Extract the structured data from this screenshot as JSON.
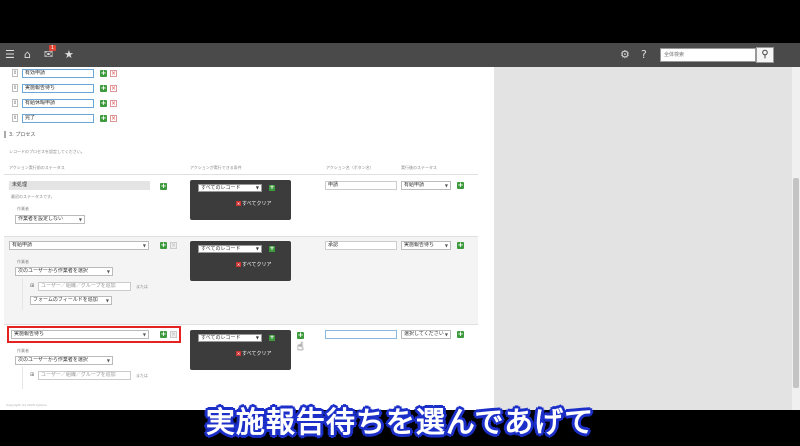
{
  "topbar": {
    "icons": [
      "menu-icon",
      "home-icon",
      "notifications-icon",
      "favorites-icon",
      "gear-icon",
      "help-icon",
      "search-icon"
    ],
    "notification_badge": "1",
    "search_placeholder": "全体検索"
  },
  "status_list": {
    "items": [
      {
        "label": "有効申請"
      },
      {
        "label": "実施報告待ち"
      },
      {
        "label": "有給休暇申請"
      },
      {
        "label": "完了"
      }
    ]
  },
  "process": {
    "section_title": "3. プロセス",
    "description": "レコードのプロセスを設定してください。",
    "col_status": "アクション実行前のステータス",
    "col_condition": "アクションが実行できる条件",
    "col_action": "アクション名（ボタン名）",
    "col_after": "実行後のステータス",
    "rows": [
      {
        "status": "未処理",
        "status_note": "最初のステータスです。",
        "assignee_label": "作業者",
        "assignee_value": "作業者を設定しない",
        "condition": "すべてのレコード",
        "clear_label": "すべてクリア",
        "action_name": "申請",
        "after_status": "有給申請"
      },
      {
        "status": "有給申請",
        "assignee_label": "作業者",
        "assignee_value": "次のユーザーから作業者を選択",
        "user_add_placeholder": "ユーザー／組織／グループを追加",
        "or_label": "または",
        "form_field": "フォームのフィールドを追加",
        "condition": "すべてのレコード",
        "clear_label": "すべてクリア",
        "action_name": "承認",
        "after_status": "実施報告待ち"
      },
      {
        "status": "実施報告待ち",
        "assignee_label": "作業者",
        "assignee_value": "次のユーザーから作業者を選択",
        "user_add_placeholder": "ユーザー／組織／グループを追加",
        "or_label": "または",
        "condition": "すべてのレコード",
        "clear_label": "すべてクリア",
        "action_name": "",
        "after_status": "選択してください"
      }
    ]
  },
  "footer": {
    "copyright": "Copyright (C) 2020 Cybozu"
  },
  "caption": "実施報告待ちを選んであげて",
  "colors": {
    "topbar": "#4a4a4a",
    "highlight_red": "#e52222",
    "caption_outline": "#1c2fc9",
    "add_green": "#3c9a3c"
  }
}
